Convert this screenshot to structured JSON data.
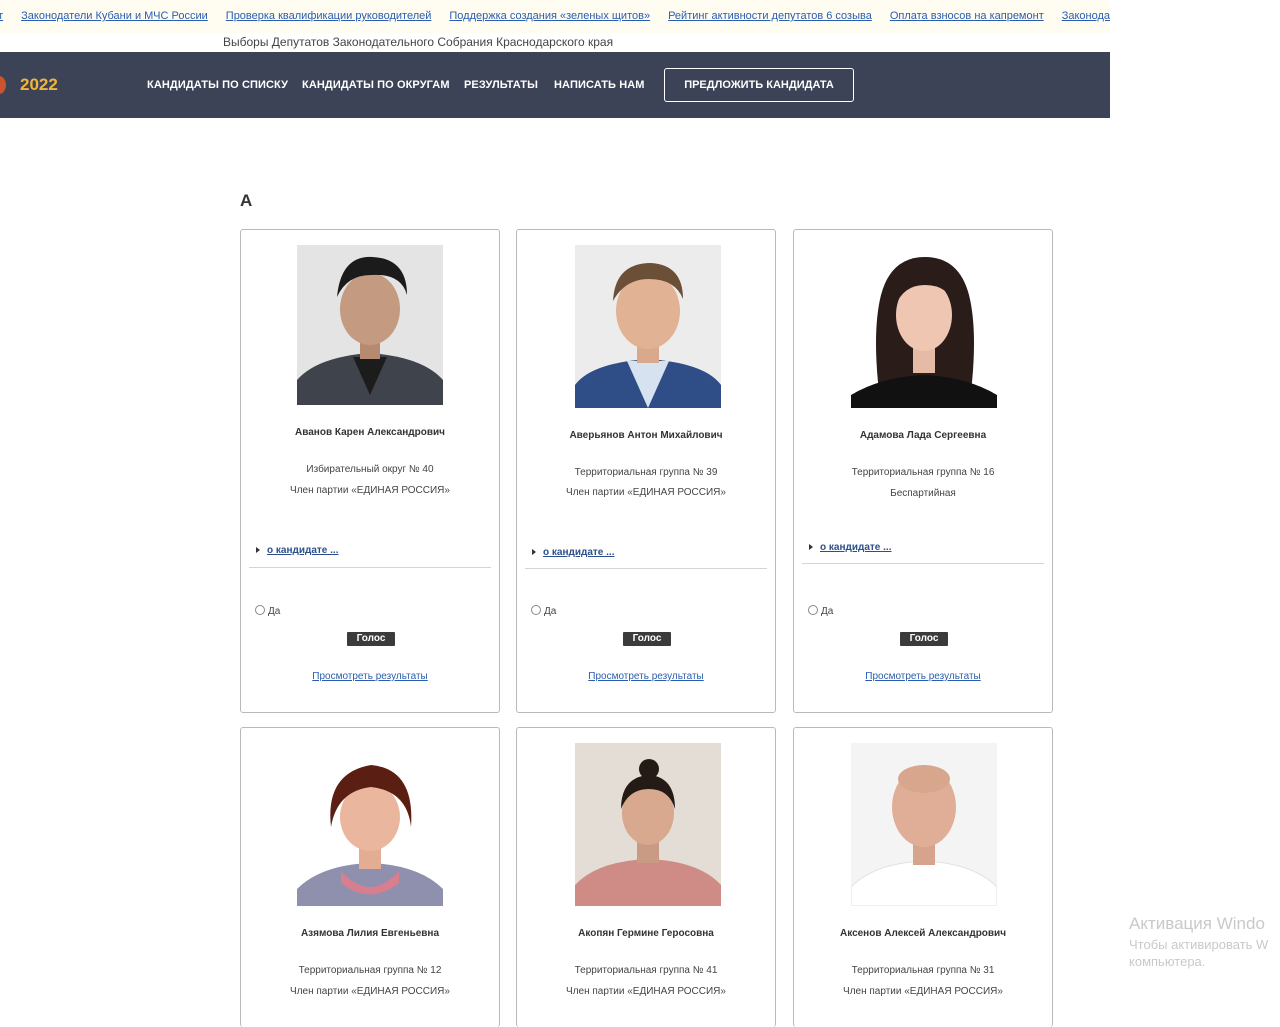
{
  "top_links": [
    "нт",
    "Законодатели Кубани и МЧС России",
    "Проверка квалификации руководителей",
    "Поддержка создания «зеленых щитов»",
    "Рейтинг активности депутатов 6 созыва",
    "Оплата взносов на капремонт",
    "Законодат"
  ],
  "subtitle": "Выборы Депутатов Законодательного Собрания Краснодарского края",
  "nav": {
    "year": "2022",
    "items": [
      "КАНДИДАТЫ ПО СПИСКУ",
      "КАНДИДАТЫ ПО ОКРУГАМ",
      "РЕЗУЛЬТАТЫ",
      "НАПИСАТЬ НАМ"
    ],
    "suggest_button": "ПРЕДЛОЖИТЬ КАНДИДАТА"
  },
  "section_letter": "А",
  "card_labels": {
    "about": "о кандидате ...",
    "radio": "Да",
    "vote": "Голос",
    "results": "Просмотреть результаты"
  },
  "candidates": [
    {
      "name": "Аванов Карен Александрович",
      "line1": "Избирательный округ № 40",
      "line2": "Член партии «ЕДИНАЯ РОССИЯ»"
    },
    {
      "name": "Аверьянов Антон Михайлович",
      "line1": "Территориальная группа № 39",
      "line2": "Член партии «ЕДИНАЯ РОССИЯ»"
    },
    {
      "name": "Адамова Лада Сергеевна",
      "line1": "Территориальная группа № 16",
      "line2": "Беспартийная"
    },
    {
      "name": "Азямова Лилия Евгеньевна",
      "line1": "Территориальная группа № 12",
      "line2": "Член партии «ЕДИНАЯ РОССИЯ»"
    },
    {
      "name": "Акопян Гермине Геросовна",
      "line1": "Территориальная группа № 41",
      "line2": "Член партии «ЕДИНАЯ РОССИЯ»"
    },
    {
      "name": "Аксенов Алексей Александрович",
      "line1": "Территориальная группа № 31",
      "line2": "Член партии «ЕДИНАЯ РОССИЯ»"
    }
  ],
  "watermark": {
    "line1": "Активация Windo",
    "line2": "Чтобы активировать W",
    "line3": "компьютера."
  },
  "colors": {
    "navbar": "#3d4356",
    "year_accent": "#f2b43a",
    "link": "#2a5db0",
    "vote_button": "#3b3b3b"
  }
}
